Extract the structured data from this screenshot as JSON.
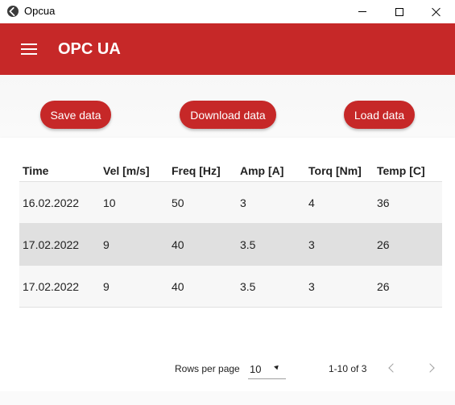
{
  "window": {
    "title": "Opcua"
  },
  "appbar": {
    "title": "OPC UA"
  },
  "actions": {
    "save_label": "Save data",
    "download_label": "Download data",
    "load_label": "Load data"
  },
  "table": {
    "columns": [
      "Time",
      "Vel [m/s]",
      "Freq [Hz]",
      "Amp [A]",
      "Torq [Nm]",
      "Temp [C]"
    ],
    "rows": [
      [
        "16.02.2022",
        "10",
        "50",
        "3",
        "4",
        "36"
      ],
      [
        "17.02.2022",
        "9",
        "40",
        "3.5",
        "3",
        "26"
      ],
      [
        "17.02.2022",
        "9",
        "40",
        "3.5",
        "3",
        "26"
      ]
    ]
  },
  "pagination": {
    "rows_per_page_label": "Rows per page",
    "rows_per_page_value": "10",
    "range_text": "1-10 of 3"
  },
  "colors": {
    "primary": "#c62828",
    "selected_row": "#e0e0e0"
  }
}
